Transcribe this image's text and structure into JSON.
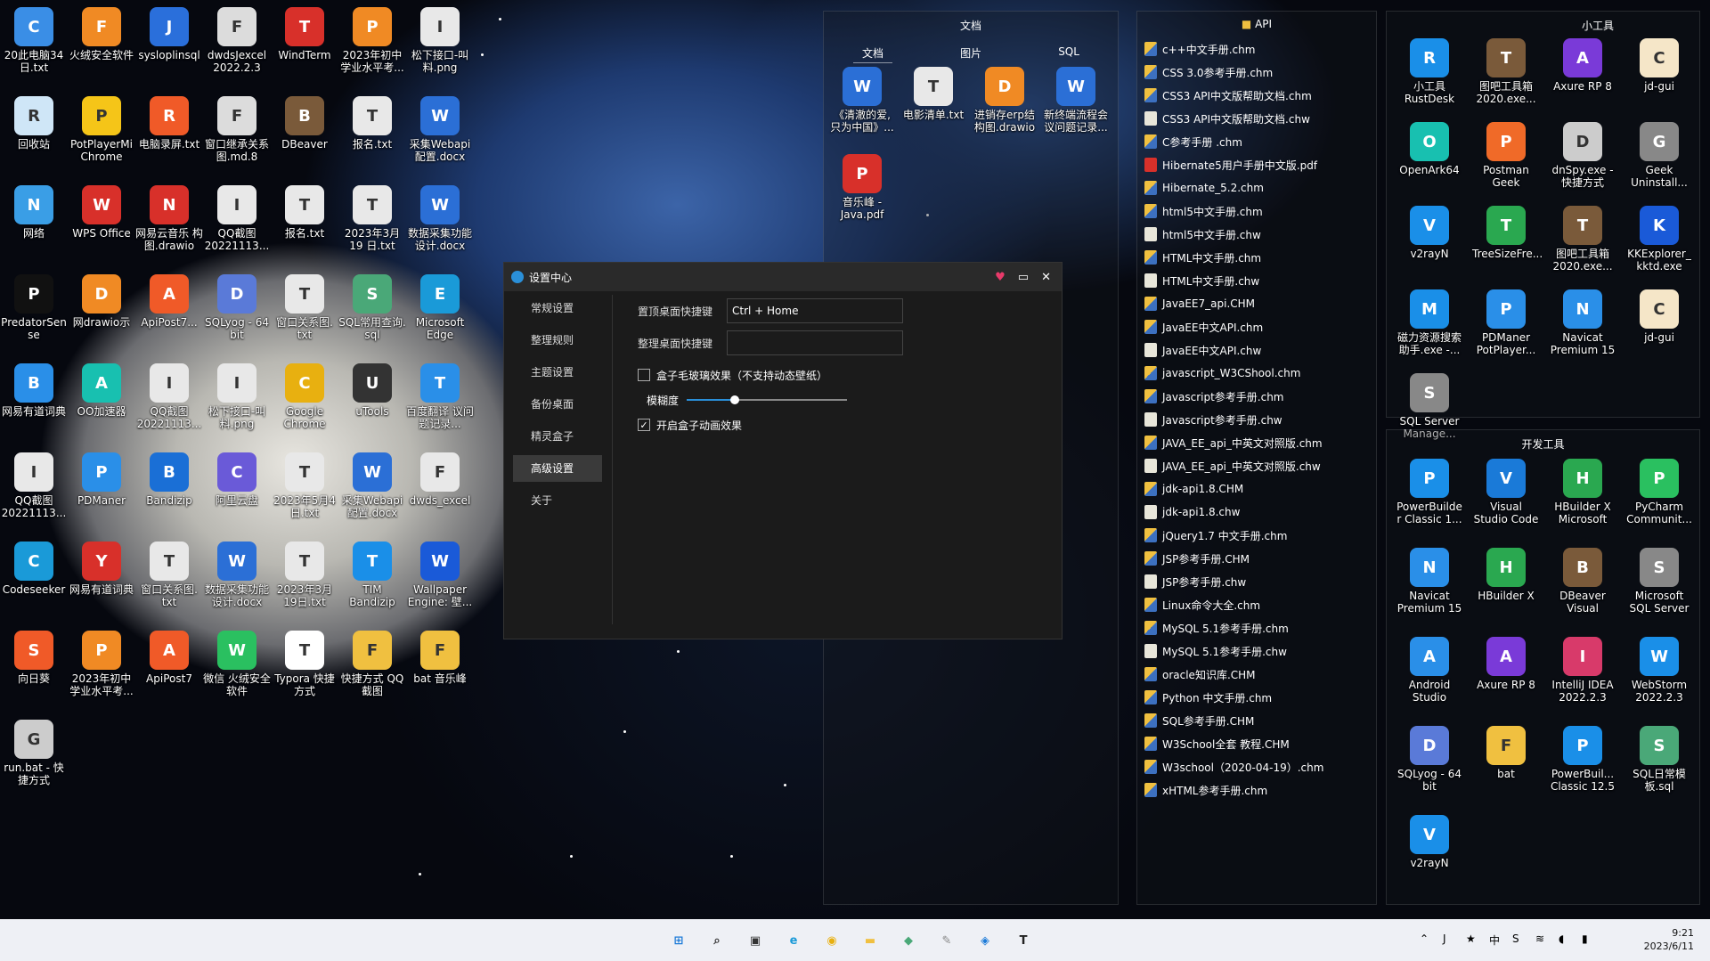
{
  "desktop_icons": [
    {
      "label": "20此电脑34\n日.txt",
      "icon": "computer-icon",
      "color": "#3a8ee6"
    },
    {
      "label": "火绒安全软件",
      "icon": "fire-icon",
      "color": "#f08a24"
    },
    {
      "label": "sysloplinsql",
      "icon": "j-icon",
      "color": "#2a6fdb"
    },
    {
      "label": "dwdsJexcel\n2022.2.3",
      "icon": "file-icon",
      "color": "#dcdcdc"
    },
    {
      "label": "WindTerm",
      "icon": "terminal-icon",
      "color": "#d8302a"
    },
    {
      "label": "2023年初中\n学业水平考...",
      "icon": "pdf-icon",
      "color": "#f08a24"
    },
    {
      "label": "松下接口-叫\n料.png",
      "icon": "image-icon",
      "color": "#e8e8e8"
    },
    {
      "label": "回收站",
      "icon": "recycle-bin-icon",
      "color": "#cfe6f7"
    },
    {
      "label": "PotPlayerMi\nChrome",
      "icon": "player-icon",
      "color": "#f5c518"
    },
    {
      "label": "电脑录屏.txt",
      "icon": "record-icon",
      "color": "#f05a28"
    },
    {
      "label": "窗口继承关系\n图.md.8",
      "icon": "file-icon",
      "color": "#dcdcdc"
    },
    {
      "label": "DBeaver",
      "icon": "beaver-icon",
      "color": "#7a5a3a"
    },
    {
      "label": "报名.txt",
      "icon": "text-file-icon",
      "color": "#e8e8e8"
    },
    {
      "label": "采集Webapi\n配置.docx",
      "icon": "word-icon",
      "color": "#2b6fd6"
    },
    {
      "label": "网络",
      "icon": "network-icon",
      "color": "#3a9ee6"
    },
    {
      "label": "WPS Office",
      "icon": "wps-icon",
      "color": "#d8302a"
    },
    {
      "label": "网易云音乐\n构图.drawio",
      "icon": "netease-icon",
      "color": "#d8302a"
    },
    {
      "label": "QQ截图\n20221113...",
      "icon": "image-icon",
      "color": "#e8e8e8"
    },
    {
      "label": "报名.txt",
      "icon": "text-file-icon",
      "color": "#e8e8e8"
    },
    {
      "label": "2023年3月19\n日.txt",
      "icon": "text-file-icon",
      "color": "#e8e8e8"
    },
    {
      "label": "数据采集功能\n设计.docx",
      "icon": "word-icon",
      "color": "#2b6fd6"
    },
    {
      "label": "PredatorSen\nse",
      "icon": "predator-icon",
      "color": "#111"
    },
    {
      "label": "网drawio示",
      "icon": "drawio-icon",
      "color": "#f08a24"
    },
    {
      "label": "ApiPost7...",
      "icon": "apipost-icon",
      "color": "#f05a28"
    },
    {
      "label": "SQLyog - 64\nbit",
      "icon": "dolphin-icon",
      "color": "#5a7ad8"
    },
    {
      "label": "窗口关系图.\ntxt",
      "icon": "text-file-icon",
      "color": "#e8e8e8"
    },
    {
      "label": "SQL常用查询.\nsql",
      "icon": "sql-icon",
      "color": "#4aa878"
    },
    {
      "label": "Microsoft\nEdge",
      "icon": "edge-icon",
      "color": "#1a9ad8"
    },
    {
      "label": "网易有道词典",
      "icon": "bird-icon",
      "color": "#2a8fe8"
    },
    {
      "label": "OO加速器",
      "icon": "accelerator-icon",
      "color": "#18c0b0"
    },
    {
      "label": "QQ截图\n20221113...",
      "icon": "image-icon",
      "color": "#e8e8e8"
    },
    {
      "label": "松下接口-叫\n料.png",
      "icon": "image-icon",
      "color": "#e8e8e8"
    },
    {
      "label": "Google\nChrome",
      "icon": "chrome-icon",
      "color": "#e8b010"
    },
    {
      "label": "uTools",
      "icon": "utools-icon",
      "color": "#333"
    },
    {
      "label": "百度翻译\n议问题记录...",
      "icon": "translate-icon",
      "color": "#2a8fe8"
    },
    {
      "label": "QQ截图\n20221113...",
      "icon": "image-icon",
      "color": "#e8e8e8"
    },
    {
      "label": "PDManer",
      "icon": "pdmaner-icon",
      "color": "#2a8fe8"
    },
    {
      "label": "Bandizip",
      "icon": "bandizip-icon",
      "color": "#1a6fd6"
    },
    {
      "label": "阿里云盘",
      "icon": "cloud-icon",
      "color": "#6a5ad8"
    },
    {
      "label": "2023年5月4\n日.txt",
      "icon": "text-file-icon",
      "color": "#e8e8e8"
    },
    {
      "label": "采集Webapi\n配置.docx",
      "icon": "word-icon",
      "color": "#2b6fd6"
    },
    {
      "label": "dwds_excel",
      "icon": "file-icon",
      "color": "#e8e8e8"
    },
    {
      "label": "Codeseeker",
      "icon": "codeseeker-icon",
      "color": "#1a9ad8"
    },
    {
      "label": "网易有道词典",
      "icon": "youdao-icon",
      "color": "#d8302a"
    },
    {
      "label": "窗口关系图.\ntxt",
      "icon": "text-file-icon",
      "color": "#e8e8e8"
    },
    {
      "label": "数据采集功能\n设计.docx",
      "icon": "word-icon",
      "color": "#2b6fd6"
    },
    {
      "label": "2023年3月\n19日.txt",
      "icon": "text-file-icon",
      "color": "#e8e8e8"
    },
    {
      "label": "TIM\nBandizip",
      "icon": "tim-icon",
      "color": "#1a8fe8"
    },
    {
      "label": "Wallpaper\nEngine: 壁...",
      "icon": "wallpaper-icon",
      "color": "#1a5ad8"
    },
    {
      "label": "向日葵",
      "icon": "sunflower-icon",
      "color": "#f05a28"
    },
    {
      "label": "2023年初中\n学业水平考...",
      "icon": "pdf-icon",
      "color": "#f08a24"
    },
    {
      "label": "ApiPost7",
      "icon": "apipost-icon",
      "color": "#f05a28"
    },
    {
      "label": "微信\n火绒安全软件",
      "icon": "wechat-icon",
      "color": "#2ac060"
    },
    {
      "label": "Typora\n快捷方式",
      "icon": "typora-icon",
      "color": "#fff"
    },
    {
      "label": "快捷方式\nQQ截图\n20221113...",
      "icon": "folder-icon",
      "color": "#f0c040"
    },
    {
      "label": "bat\n音乐峰\n-Java.pdf",
      "icon": "folder-icon",
      "color": "#f0c040"
    },
    {
      "label": "run.bat - 快\n捷方式",
      "icon": "gear-file-icon",
      "color": "#ccc"
    }
  ],
  "fence_docs": {
    "title": "文档",
    "tabs": [
      "文档",
      "图片",
      "SQL"
    ],
    "items": [
      {
        "label": "《清澈的爱,\n只为中国》...",
        "icon": "word-icon",
        "color": "#2b6fd6"
      },
      {
        "label": "电影清单.txt",
        "icon": "text-file-icon",
        "color": "#e8e8e8"
      },
      {
        "label": "进销存erp结\n构图.drawio",
        "icon": "drawio-icon",
        "color": "#f08a24"
      },
      {
        "label": "新终端流程会\n议问题记录...",
        "icon": "word-icon",
        "color": "#2b6fd6"
      },
      {
        "label": "音乐峰\n-Java.pdf",
        "icon": "pdf-icon",
        "color": "#d8302a"
      }
    ]
  },
  "fence_api": {
    "title": "API",
    "files": [
      {
        "name": "c++中文手册.chm",
        "type": "chm"
      },
      {
        "name": "CSS 3.0参考手册.chm",
        "type": "chm"
      },
      {
        "name": "CSS3 API中文版帮助文档.chm",
        "type": "chm"
      },
      {
        "name": "CSS3 API中文版帮助文档.chw",
        "type": "chw"
      },
      {
        "name": "C参考手册 .chm",
        "type": "chm"
      },
      {
        "name": "Hibernate5用户手册中文版.pdf",
        "type": "pdf"
      },
      {
        "name": "Hibernate_5.2.chm",
        "type": "chm"
      },
      {
        "name": "html5中文手册.chm",
        "type": "chm"
      },
      {
        "name": "html5中文手册.chw",
        "type": "chw"
      },
      {
        "name": "HTML中文手册.chm",
        "type": "chm"
      },
      {
        "name": "HTML中文手册.chw",
        "type": "chw"
      },
      {
        "name": "JavaEE7_api.CHM",
        "type": "chm"
      },
      {
        "name": "JavaEE中文API.chm",
        "type": "chm"
      },
      {
        "name": "JavaEE中文API.chw",
        "type": "chw"
      },
      {
        "name": "javascript_W3CShool.chm",
        "type": "chm"
      },
      {
        "name": "Javascript参考手册.chm",
        "type": "chm"
      },
      {
        "name": "Javascript参考手册.chw",
        "type": "chw"
      },
      {
        "name": "JAVA_EE_api_中英文对照版.chm",
        "type": "chm"
      },
      {
        "name": "JAVA_EE_api_中英文对照版.chw",
        "type": "chw"
      },
      {
        "name": "jdk-api1.8.CHM",
        "type": "chm"
      },
      {
        "name": "jdk-api1.8.chw",
        "type": "chw"
      },
      {
        "name": "jQuery1.7 中文手册.chm",
        "type": "chm"
      },
      {
        "name": "JSP参考手册.CHM",
        "type": "chm"
      },
      {
        "name": "JSP参考手册.chw",
        "type": "chw"
      },
      {
        "name": "Linux命令大全.chm",
        "type": "chm"
      },
      {
        "name": "MySQL 5.1参考手册.chm",
        "type": "chm"
      },
      {
        "name": "MySQL 5.1参考手册.chw",
        "type": "chw"
      },
      {
        "name": "oracle知识库.CHM",
        "type": "chm"
      },
      {
        "name": "Python 中文手册.chm",
        "type": "chm"
      },
      {
        "name": "SQL参考手册.CHM",
        "type": "chm"
      },
      {
        "name": "W3School全套 教程.CHM",
        "type": "chm"
      },
      {
        "name": "W3school（2020-04-19）.chm",
        "type": "chm"
      },
      {
        "name": "xHTML参考手册.chm",
        "type": "chm"
      }
    ]
  },
  "fence_tools": {
    "title": "小工具",
    "items": [
      {
        "label": "小工具\nRustDesk",
        "icon": "rustdesk-icon",
        "color": "#1a8fe8"
      },
      {
        "label": "图吧工具箱\n2020.exe...",
        "icon": "toolbox-icon",
        "color": "#7a5a3a"
      },
      {
        "label": "Axure RP 8",
        "icon": "axure-icon",
        "color": "#7a3ad8"
      },
      {
        "label": "jd-gui",
        "icon": "coffee-icon",
        "color": "#f5e6c8"
      },
      {
        "label": "OpenArk64",
        "icon": "openark-icon",
        "color": "#18c0b0"
      },
      {
        "label": "Postman\nGeek",
        "icon": "postman-icon",
        "color": "#f06a28"
      },
      {
        "label": "dnSpy.exe -\n快捷方式\nPostman",
        "icon": "dnspy-icon",
        "color": "#ccc"
      },
      {
        "label": "Geek\nUninstall...",
        "icon": "geek-icon",
        "color": "#888"
      },
      {
        "label": "v2rayN",
        "icon": "v2ray-icon",
        "color": "#1a8fe8"
      },
      {
        "label": "TreeSizeFre...",
        "icon": "treesize-icon",
        "color": "#2aa850"
      },
      {
        "label": "图吧工具箱\n2020.exe...",
        "icon": "toolbox-icon",
        "color": "#7a5a3a"
      },
      {
        "label": "KKExplorer_\nkktd.exe",
        "icon": "kk-icon",
        "color": "#1a5ad8"
      },
      {
        "label": "磁力资源搜索\n助手.exe -...",
        "icon": "magnet-icon",
        "color": "#1a8fe8"
      },
      {
        "label": "PDManer\nPotPlayer...",
        "icon": "pdmaner-icon",
        "color": "#2a8fe8"
      },
      {
        "label": "Navicat\nPremium 15",
        "icon": "navicat-icon",
        "color": "#2a8fe8"
      },
      {
        "label": "jd-gui",
        "icon": "coffee-icon",
        "color": "#f5e6c8"
      },
      {
        "label": "SQL Server\nManage...",
        "icon": "sqlserver-icon",
        "color": "#888"
      }
    ]
  },
  "fence_dev": {
    "title": "开发工具",
    "items": [
      {
        "label": "PowerBuilde\nr Classic 1...",
        "icon": "powerbuilder-icon",
        "color": "#1a8fe8"
      },
      {
        "label": "Visual\nStudio Code",
        "icon": "vscode-icon",
        "color": "#1a7ad8"
      },
      {
        "label": "HBuilder X\nMicrosoft\nVisual Stud...",
        "icon": "hbuilder-icon",
        "color": "#2aa850"
      },
      {
        "label": "PyCharm\nCommunit...",
        "icon": "pycharm-icon",
        "color": "#2ac060"
      },
      {
        "label": "Navicat\nPremium 15",
        "icon": "navicat-icon",
        "color": "#2a8fe8"
      },
      {
        "label": "HBuilder X",
        "icon": "hbuilder-icon",
        "color": "#2aa850"
      },
      {
        "label": "DBeaver\nVisual\nStudio Code",
        "icon": "beaver-icon",
        "color": "#7a5a3a"
      },
      {
        "label": "Microsoft\nSQL Server\nManagem...",
        "icon": "sqlserver-icon",
        "color": "#888"
      },
      {
        "label": "Android\nStudio",
        "icon": "android-studio-icon",
        "color": "#2a8fe8"
      },
      {
        "label": "Axure RP 8",
        "icon": "axure-icon",
        "color": "#7a3ad8"
      },
      {
        "label": "IntelliJ IDEA\n2022.2.3",
        "icon": "idea-icon",
        "color": "#d83a6a"
      },
      {
        "label": "WebStorm\n2022.2.3",
        "icon": "webstorm-icon",
        "color": "#1a8fe8"
      },
      {
        "label": "SQLyog - 64\nbit",
        "icon": "dolphin-icon",
        "color": "#5a7ad8"
      },
      {
        "label": "bat",
        "icon": "folder-icon",
        "color": "#f0c040"
      },
      {
        "label": "PowerBuil...\nClassic 12.5",
        "icon": "powerbuilder-icon",
        "color": "#1a8fe8"
      },
      {
        "label": "SQL日常模\n板.sql",
        "icon": "sql-icon",
        "color": "#4aa878"
      },
      {
        "label": "v2rayN",
        "icon": "v2ray-icon",
        "color": "#1a8fe8"
      }
    ]
  },
  "dialog": {
    "title": "设置中心",
    "nav": [
      "常规设置",
      "整理规则",
      "主题设置",
      "备份桌面",
      "精灵盒子",
      "高级设置",
      "关于"
    ],
    "active_nav": "高级设置",
    "fields": {
      "top_hotkey_label": "置顶桌面快捷键",
      "top_hotkey_value": "Ctrl + Home",
      "arrange_hotkey_label": "整理桌面快捷键",
      "arrange_hotkey_value": "",
      "glass_label": "盒子毛玻璃效果（不支持动态壁纸）",
      "glass_checked": false,
      "blur_label": "模糊度",
      "blur_level": 0.3,
      "anim_label": "开启盒子动画效果",
      "anim_checked": true
    }
  },
  "taskbar": {
    "icons": [
      "windows-start-icon",
      "search-icon",
      "task-view-icon",
      "edge-icon",
      "chrome-icon",
      "file-explorer-icon",
      "sql-icon",
      "tool-icon",
      "vscode-icon",
      "typora-icon"
    ],
    "tray_icons": [
      "chevron-up-icon",
      "j-icon",
      "tim-icon",
      "ime-icon",
      "wps-icon",
      "wifi-icon",
      "volume-icon",
      "battery-icon"
    ],
    "time": "9:21",
    "date": "2023/6/11"
  },
  "colors": {
    "taskbar": "#eef0f5",
    "dialog_bg": "#1b1b1b",
    "accent": "#2a8fd8",
    "slider": "#ffffff"
  }
}
